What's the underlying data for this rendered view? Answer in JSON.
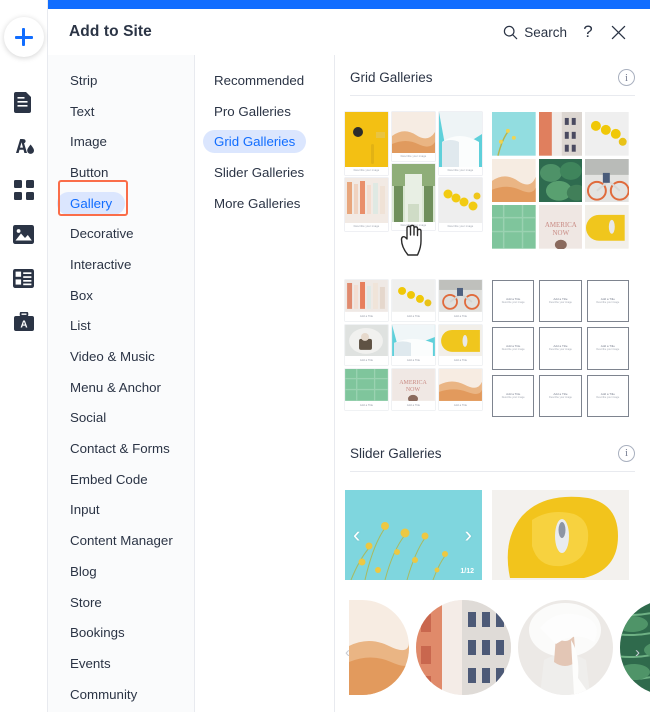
{
  "window": {
    "accent_color": "#116dff",
    "title": "Add to Site"
  },
  "rail": {
    "add_label": "+",
    "icons": [
      {
        "name": "add-element-icon",
        "label": "Add"
      },
      {
        "name": "pages-icon",
        "label": "Pages"
      },
      {
        "name": "theme-manager-icon",
        "label": "Theme Manager"
      },
      {
        "name": "apps-icon",
        "label": "Apps"
      },
      {
        "name": "media-icon",
        "label": "Media"
      },
      {
        "name": "content-manager-icon",
        "label": "Content Manager"
      },
      {
        "name": "business-tools-icon",
        "label": "Business Tools"
      }
    ]
  },
  "header": {
    "title": "Add to Site",
    "search_label": "Search",
    "help_label": "?",
    "close_label": "✕"
  },
  "categories": {
    "selected": "Gallery",
    "items": [
      {
        "label": "Strip"
      },
      {
        "label": "Text"
      },
      {
        "label": "Image"
      },
      {
        "label": "Button"
      },
      {
        "label": "Gallery"
      },
      {
        "label": "Decorative"
      },
      {
        "label": "Interactive"
      },
      {
        "label": "Box"
      },
      {
        "label": "List"
      },
      {
        "label": "Video & Music"
      },
      {
        "label": "Menu & Anchor"
      },
      {
        "label": "Social"
      },
      {
        "label": "Contact & Forms"
      },
      {
        "label": "Embed Code"
      },
      {
        "label": "Input"
      },
      {
        "label": "Content Manager"
      },
      {
        "label": "Blog"
      },
      {
        "label": "Store"
      },
      {
        "label": "Bookings"
      },
      {
        "label": "Events"
      },
      {
        "label": "Community"
      }
    ]
  },
  "subcategories": {
    "selected": "Grid Galleries",
    "items": [
      {
        "label": "Recommended"
      },
      {
        "label": "Pro Galleries"
      },
      {
        "label": "Grid Galleries"
      },
      {
        "label": "Slider Galleries"
      },
      {
        "label": "More Galleries"
      }
    ]
  },
  "sections": [
    {
      "title": "Grid Galleries",
      "info_label": "i",
      "items": [
        {
          "name": "masonry-gallery",
          "caption": "Describe your image"
        },
        {
          "name": "square-grid-gallery",
          "caption": ""
        },
        {
          "name": "titled-grid-gallery",
          "caption": "Add a Title"
        },
        {
          "name": "framed-grid-gallery",
          "caption_title": "Add a Title",
          "caption_desc": "Describe your image"
        }
      ]
    },
    {
      "title": "Slider Galleries",
      "info_label": "i",
      "items": [
        {
          "name": "slider-gallery",
          "counter": "1/12",
          "prev": "‹",
          "next": "›"
        },
        {
          "name": "fullwidth-slider-gallery"
        },
        {
          "name": "circular-carousel-gallery",
          "prev": "‹",
          "next": "›"
        }
      ]
    }
  ]
}
